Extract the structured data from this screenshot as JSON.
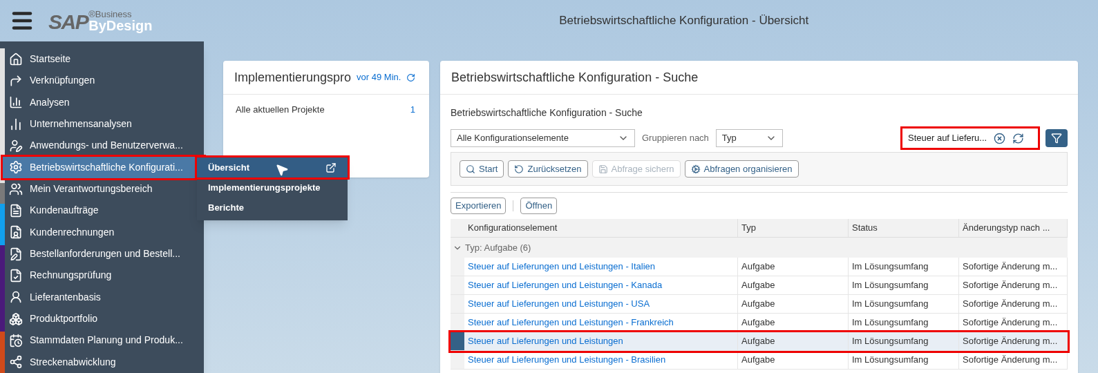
{
  "header": {
    "logo": {
      "brand": "SAP",
      "registered": "®",
      "line1": "Business",
      "line2": "ByDesign"
    },
    "title": "Betriebswirtschaftliche Konfiguration - Übersicht"
  },
  "sidebar": {
    "items": [
      {
        "label": "Startseite",
        "selected": false,
        "annotated": false
      },
      {
        "label": "Verknüpfungen",
        "selected": false,
        "annotated": false
      },
      {
        "label": "Analysen",
        "selected": false,
        "annotated": false
      },
      {
        "label": "Unternehmensanalysen",
        "selected": false,
        "annotated": false
      },
      {
        "label": "Anwendungs- und Benutzerverwa...",
        "selected": false,
        "annotated": false
      },
      {
        "label": "Betriebswirtschaftliche Konfigurati...",
        "selected": true,
        "annotated": true
      },
      {
        "label": "Mein Verantwortungsbereich",
        "selected": false,
        "annotated": false
      },
      {
        "label": "Kundenaufträge",
        "selected": false,
        "annotated": false
      },
      {
        "label": "Kundenrechnungen",
        "selected": false,
        "annotated": false
      },
      {
        "label": "Bestellanforderungen und Bestell...",
        "selected": false,
        "annotated": false
      },
      {
        "label": "Rechnungsprüfung",
        "selected": false,
        "annotated": false
      },
      {
        "label": "Lieferantenbasis",
        "selected": false,
        "annotated": false
      },
      {
        "label": "Produktportfolio",
        "selected": false,
        "annotated": false
      },
      {
        "label": "Stammdaten Planung und Produk...",
        "selected": false,
        "annotated": false
      },
      {
        "label": "Streckenabwicklung",
        "selected": false,
        "annotated": false
      }
    ]
  },
  "flyout": {
    "items": [
      {
        "label": "Übersicht",
        "selected": true,
        "annotated": true
      },
      {
        "label": "Implementierungsprojekte",
        "selected": false,
        "annotated": false
      },
      {
        "label": "Berichte",
        "selected": false,
        "annotated": false
      }
    ]
  },
  "project_card": {
    "title": "Implementierungspro",
    "timestamp": "vor 49 Min.",
    "rows": [
      {
        "label": "Alle aktuellen Projekte",
        "count": "1"
      }
    ]
  },
  "search_card": {
    "title": "Betriebswirtschaftliche Konfiguration - Suche",
    "subtitle": "Betriebswirtschaftliche Konfiguration - Suche",
    "filter": {
      "value": "Alle Konfigurationselemente"
    },
    "group_by": {
      "label": "Gruppieren nach",
      "value": "Typ"
    },
    "search": {
      "value": "Steuer auf Lieferu...",
      "annotated": true
    },
    "query_buttons": [
      {
        "label": "Start",
        "disabled": false
      },
      {
        "label": "Zurücksetzen",
        "disabled": false
      },
      {
        "label": "Abfrage sichern",
        "disabled": true
      },
      {
        "label": "Abfragen organisieren",
        "disabled": false
      }
    ],
    "actions": [
      {
        "label": "Exportieren"
      },
      {
        "label": "Öffnen"
      }
    ],
    "table": {
      "columns": [
        "Konfigurationselement",
        "Typ",
        "Status",
        "Änderungstyp nach ..."
      ],
      "group": {
        "label": "Typ: Aufgabe (6)",
        "expanded": true
      },
      "rows": [
        {
          "cells": [
            "Steuer auf Lieferungen und Leistungen - Italien",
            "Aufgabe",
            "Im Lösungsumfang",
            "Sofortige Änderung m..."
          ],
          "selected": false,
          "annotated": false
        },
        {
          "cells": [
            "Steuer auf Lieferungen und Leistungen - Kanada",
            "Aufgabe",
            "Im Lösungsumfang",
            "Sofortige Änderung m..."
          ],
          "selected": false,
          "annotated": false
        },
        {
          "cells": [
            "Steuer auf Lieferungen und Leistungen - USA",
            "Aufgabe",
            "Im Lösungsumfang",
            "Sofortige Änderung m..."
          ],
          "selected": false,
          "annotated": false
        },
        {
          "cells": [
            "Steuer auf Lieferungen und Leistungen - Frankreich",
            "Aufgabe",
            "Im Lösungsumfang",
            "Sofortige Änderung m..."
          ],
          "selected": false,
          "annotated": false
        },
        {
          "cells": [
            "Steuer auf Lieferungen und Leistungen",
            "Aufgabe",
            "Im Lösungsumfang",
            "Sofortige Änderung m..."
          ],
          "selected": true,
          "annotated": true
        },
        {
          "cells": [
            "Steuer auf Lieferungen und Leistungen - Brasilien",
            "Aufgabe",
            "Im Lösungsumfang",
            "Sofortige Änderung m..."
          ],
          "selected": false,
          "annotated": false
        }
      ]
    }
  }
}
